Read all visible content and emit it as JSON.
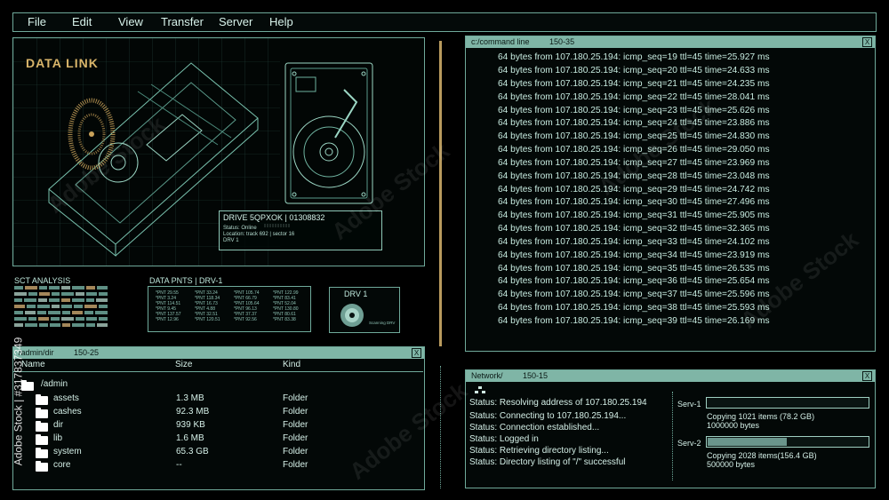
{
  "menu": [
    "File",
    "Edit",
    "View",
    "Transfer",
    "Server",
    "Help"
  ],
  "data_link": {
    "title": "DATA LINK",
    "drive_info": {
      "title": "DRIVE 5QPXOK | 01308832",
      "status": "Status: Online",
      "location": "Location: track 692 | sector 16",
      "drv": "DRV 1"
    }
  },
  "analysis": {
    "sct_title": "SCT ANALYSIS",
    "data_pnts_title": "DATA PNTS | DRV-1",
    "data_pnts": [
      [
        "*PNT 29.55",
        "*PNT 3.24",
        "*PNT 114.51",
        "*PNT 9.45",
        "*PNT 137.57",
        "*PNT 12.96"
      ],
      [
        "*PNT 33.24",
        "*PNT 118.34",
        "*PNT 16.73",
        "*PNT 4.88",
        "*PNT 32.51",
        "*PNT 120.51"
      ],
      [
        "*PNT 105.74",
        "*PNT 66.79",
        "*PNT 105.64",
        "*PNT 96.13",
        "*PNT 37.37",
        "*PNT 92.56"
      ],
      [
        "*PNT 122.99",
        "*PNT 83.41",
        "*PNT 52.04",
        "*PNT 130.80",
        "*PNT 80.61",
        "*PNT 83.38"
      ]
    ],
    "drv_title": "DRV 1",
    "drv_caption": "Scanning DRV"
  },
  "dir_panel": {
    "path": "/admin/dir",
    "count": "150-25",
    "close": "X",
    "columns": [
      "Name",
      "Size",
      "Kind"
    ],
    "root": "/admin",
    "rows": [
      {
        "name": "assets",
        "size": "1.3 MB",
        "kind": "Folder"
      },
      {
        "name": "cashes",
        "size": "92.3 MB",
        "kind": "Folder"
      },
      {
        "name": "dir",
        "size": "939 KB",
        "kind": "Folder"
      },
      {
        "name": "lib",
        "size": "1.6 MB",
        "kind": "Folder"
      },
      {
        "name": "system",
        "size": "65.3 GB",
        "kind": "Folder"
      },
      {
        "name": "core",
        "size": "--",
        "kind": "Folder"
      }
    ]
  },
  "cmd_panel": {
    "path": "c:/command line",
    "count": "150-35",
    "close": "X",
    "lines": [
      "64 bytes from 107.180.25.194: icmp_seq=19 ttl=45 time=25.927 ms",
      "64 bytes from 107.180.25.194: icmp_seq=20 ttl=45 time=24.633 ms",
      "64 bytes from 107.180.25.194: icmp_seq=21 ttl=45 time=24.235 ms",
      "64 bytes from 107.180.25.194: icmp_seq=22 ttl=45 time=28.041 ms",
      "64 bytes from 107.180.25.194: icmp_seq=23 ttl=45 time=25.626 ms",
      "64 bytes from 107.180.25.194: icmp_seq=24 ttl=45 time=23.886 ms",
      "64 bytes from 107.180.25.194: icmp_seq=25 ttl=45 time=24.830 ms",
      "64 bytes from 107.180.25.194: icmp_seq=26 ttl=45 time=29.050 ms",
      "64 bytes from 107.180.25.194: icmp_seq=27 ttl=45 time=23.969 ms",
      "64 bytes from 107.180.25.194: icmp_seq=28 ttl=45 time=23.048 ms",
      "64 bytes from 107.180.25.194: icmp_seq=29 ttl=45 time=24.742 ms",
      "64 bytes from 107.180.25.194: icmp_seq=30 ttl=45 time=27.496 ms",
      "64 bytes from 107.180.25.194: icmp_seq=31 ttl=45 time=25.905 ms",
      "64 bytes from 107.180.25.194: icmp_seq=32 ttl=45 time=32.365 ms",
      "64 bytes from 107.180.25.194: icmp_seq=33 ttl=45 time=24.102 ms",
      "64 bytes from 107.180.25.194: icmp_seq=34 ttl=45 time=23.919 ms",
      "64 bytes from 107.180.25.194: icmp_seq=35 ttl=45 time=26.535 ms",
      "64 bytes from 107.180.25.194: icmp_seq=36 ttl=45 time=25.654 ms",
      "64 bytes from 107.180.25.194: icmp_seq=37 ttl=45 time=25.596 ms",
      "64 bytes from 107.180.25.194: icmp_seq=38 ttl=45 time=25.593 ms",
      "64 bytes from 107.180.25.194: icmp_seq=39 ttl=45 time=26.169 ms"
    ]
  },
  "network_panel": {
    "path": "Network/",
    "count": "150-15",
    "close": "X",
    "statuses": [
      "Status: Resolving address of 107.180.25.194",
      "Status: Connecting to 107.180.25.194...",
      "Status: Connection established...",
      "Status: Logged in",
      "Status: Retrieving directory listing...",
      "Status: Directory listing of \"/\" successful"
    ],
    "servers": [
      {
        "label": "Serv-1",
        "copying": "Copying  1021 items (78.2 GB)",
        "bytes": "1000000 bytes",
        "progress": 0.0
      },
      {
        "label": "Serv-2",
        "copying": "Copying  2028 items(156.4 GB)",
        "bytes": "500000 bytes",
        "progress": 0.5
      }
    ]
  },
  "colors": {
    "frame": "#6fa99a",
    "titlebar": "#7fb5a6",
    "text": "#c8ece1",
    "accent": "#c9a25a"
  }
}
